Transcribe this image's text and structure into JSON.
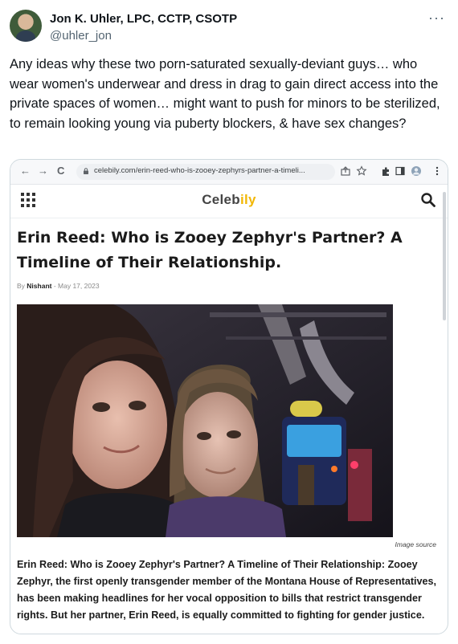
{
  "tweet": {
    "author_name": "Jon K. Uhler, LPC, CCTP, CSOTP",
    "handle": "@uhler_jon",
    "more_label": "···",
    "text": "Any ideas why these two porn-saturated sexually-deviant guys… who wear women's underwear and dress in drag to gain direct access into the private spaces of women… might want to push for minors to be sterilized, to remain looking young via puberty blockers, & have sex changes?"
  },
  "browser": {
    "back": "←",
    "forward": "→",
    "reload": "C",
    "url": "celebily.com/erin-reed-who-is-zooey-zephyrs-partner-a-timeli..."
  },
  "site": {
    "logo_main": "Celeb",
    "logo_accent": "ily",
    "accent_color": "#f2b705"
  },
  "article": {
    "title": "Erin Reed: Who is Zooey Zephyr's Partner? A Timeline of Their Relationship.",
    "by_prefix": "By",
    "author": "Nishant",
    "date": "- May 17, 2023",
    "image_source": "Image source",
    "excerpt": "Erin Reed: Who is Zooey Zephyr's Partner? A Timeline of Their Relationship: Zooey Zephyr, the first openly transgender member of the Montana House of Representatives, has been making headlines for her vocal opposition to bills that restrict transgender rights. But her partner, Erin Reed, is equally committed to fighting for gender justice."
  }
}
